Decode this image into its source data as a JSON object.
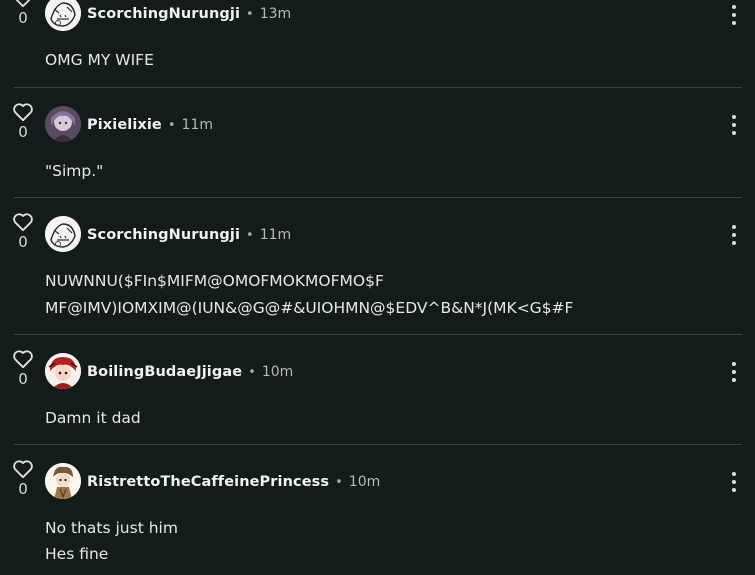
{
  "comments": [
    {
      "username": "ScorchingNurungji",
      "time": "13m",
      "likes": "0",
      "lines": [
        "OMG MY WIFE"
      ],
      "avatar": "bw-sketch-avatar"
    },
    {
      "username": "Pixielixie",
      "time": "11m",
      "likes": "0",
      "lines": [
        "\"Simp.\""
      ],
      "avatar": "purple-character-avatar"
    },
    {
      "username": "ScorchingNurungji",
      "time": "11m",
      "likes": "0",
      "lines": [
        "NUWNNU($FIn$MIFM@OMOFMOKMOFMO$F",
        "MF@IMV)IOMXIM@(IUN&@G@#&UIOHMN@$EDV^B&N*J(MK<G$#F"
      ],
      "avatar": "bw-sketch-avatar"
    },
    {
      "username": "BoilingBudaeJjigae",
      "time": "10m",
      "likes": "0",
      "lines": [
        "Damn it dad"
      ],
      "avatar": "red-character-avatar"
    },
    {
      "username": "RistrettoTheCaffeinePrincess",
      "time": "10m",
      "likes": "0",
      "lines": [
        "No thats just him",
        "Hes fine"
      ],
      "avatar": "tan-character-avatar"
    }
  ],
  "separator": "•",
  "colors": {
    "background": "#141b1b",
    "divider": "#3a4141",
    "text": "#e8e8e8",
    "muted": "#b9b9b9"
  },
  "icons": {
    "like": "heart-outline-icon",
    "more": "vertical-ellipsis-icon"
  }
}
